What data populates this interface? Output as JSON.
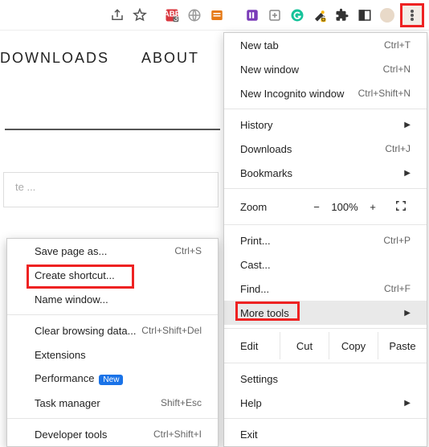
{
  "page": {
    "nav1": "DOWNLOADS",
    "nav2": "ABOUT",
    "placeholder": "te ..."
  },
  "menu": {
    "newtab": {
      "label": "New tab",
      "accel": "Ctrl+T"
    },
    "newwin": {
      "label": "New window",
      "accel": "Ctrl+N"
    },
    "incog": {
      "label": "New Incognito window",
      "accel": "Ctrl+Shift+N"
    },
    "history": {
      "label": "History"
    },
    "downloads": {
      "label": "Downloads",
      "accel": "Ctrl+J"
    },
    "bookmarks": {
      "label": "Bookmarks"
    },
    "zoom": {
      "label": "Zoom",
      "minus": "−",
      "value": "100%",
      "plus": "+"
    },
    "print": {
      "label": "Print...",
      "accel": "Ctrl+P"
    },
    "cast": {
      "label": "Cast..."
    },
    "find": {
      "label": "Find...",
      "accel": "Ctrl+F"
    },
    "more": {
      "label": "More tools"
    },
    "edit": {
      "label": "Edit",
      "cut": "Cut",
      "copy": "Copy",
      "paste": "Paste"
    },
    "settings": {
      "label": "Settings"
    },
    "help": {
      "label": "Help"
    },
    "exit": {
      "label": "Exit"
    }
  },
  "sub": {
    "save": {
      "label": "Save page as...",
      "accel": "Ctrl+S"
    },
    "shortcut": {
      "label": "Create shortcut..."
    },
    "namewin": {
      "label": "Name window..."
    },
    "clear": {
      "label": "Clear browsing data...",
      "accel": "Ctrl+Shift+Del"
    },
    "ext": {
      "label": "Extensions"
    },
    "perf": {
      "label": "Performance",
      "badge": "New"
    },
    "task": {
      "label": "Task manager",
      "accel": "Shift+Esc"
    },
    "dev": {
      "label": "Developer tools",
      "accel": "Ctrl+Shift+I"
    }
  }
}
